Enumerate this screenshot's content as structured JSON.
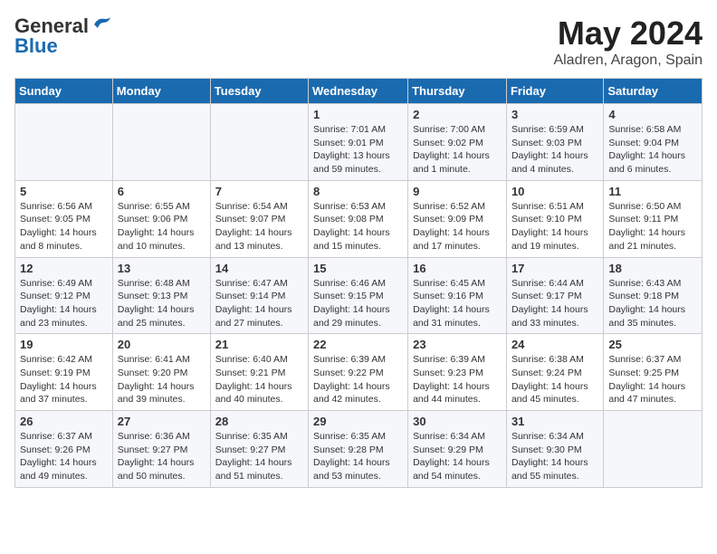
{
  "header": {
    "logo_general": "General",
    "logo_blue": "Blue",
    "month": "May 2024",
    "location": "Aladren, Aragon, Spain"
  },
  "weekdays": [
    "Sunday",
    "Monday",
    "Tuesday",
    "Wednesday",
    "Thursday",
    "Friday",
    "Saturday"
  ],
  "weeks": [
    [
      {
        "day": "",
        "info": ""
      },
      {
        "day": "",
        "info": ""
      },
      {
        "day": "",
        "info": ""
      },
      {
        "day": "1",
        "info": "Sunrise: 7:01 AM\nSunset: 9:01 PM\nDaylight: 13 hours and 59 minutes."
      },
      {
        "day": "2",
        "info": "Sunrise: 7:00 AM\nSunset: 9:02 PM\nDaylight: 14 hours and 1 minute."
      },
      {
        "day": "3",
        "info": "Sunrise: 6:59 AM\nSunset: 9:03 PM\nDaylight: 14 hours and 4 minutes."
      },
      {
        "day": "4",
        "info": "Sunrise: 6:58 AM\nSunset: 9:04 PM\nDaylight: 14 hours and 6 minutes."
      }
    ],
    [
      {
        "day": "5",
        "info": "Sunrise: 6:56 AM\nSunset: 9:05 PM\nDaylight: 14 hours and 8 minutes."
      },
      {
        "day": "6",
        "info": "Sunrise: 6:55 AM\nSunset: 9:06 PM\nDaylight: 14 hours and 10 minutes."
      },
      {
        "day": "7",
        "info": "Sunrise: 6:54 AM\nSunset: 9:07 PM\nDaylight: 14 hours and 13 minutes."
      },
      {
        "day": "8",
        "info": "Sunrise: 6:53 AM\nSunset: 9:08 PM\nDaylight: 14 hours and 15 minutes."
      },
      {
        "day": "9",
        "info": "Sunrise: 6:52 AM\nSunset: 9:09 PM\nDaylight: 14 hours and 17 minutes."
      },
      {
        "day": "10",
        "info": "Sunrise: 6:51 AM\nSunset: 9:10 PM\nDaylight: 14 hours and 19 minutes."
      },
      {
        "day": "11",
        "info": "Sunrise: 6:50 AM\nSunset: 9:11 PM\nDaylight: 14 hours and 21 minutes."
      }
    ],
    [
      {
        "day": "12",
        "info": "Sunrise: 6:49 AM\nSunset: 9:12 PM\nDaylight: 14 hours and 23 minutes."
      },
      {
        "day": "13",
        "info": "Sunrise: 6:48 AM\nSunset: 9:13 PM\nDaylight: 14 hours and 25 minutes."
      },
      {
        "day": "14",
        "info": "Sunrise: 6:47 AM\nSunset: 9:14 PM\nDaylight: 14 hours and 27 minutes."
      },
      {
        "day": "15",
        "info": "Sunrise: 6:46 AM\nSunset: 9:15 PM\nDaylight: 14 hours and 29 minutes."
      },
      {
        "day": "16",
        "info": "Sunrise: 6:45 AM\nSunset: 9:16 PM\nDaylight: 14 hours and 31 minutes."
      },
      {
        "day": "17",
        "info": "Sunrise: 6:44 AM\nSunset: 9:17 PM\nDaylight: 14 hours and 33 minutes."
      },
      {
        "day": "18",
        "info": "Sunrise: 6:43 AM\nSunset: 9:18 PM\nDaylight: 14 hours and 35 minutes."
      }
    ],
    [
      {
        "day": "19",
        "info": "Sunrise: 6:42 AM\nSunset: 9:19 PM\nDaylight: 14 hours and 37 minutes."
      },
      {
        "day": "20",
        "info": "Sunrise: 6:41 AM\nSunset: 9:20 PM\nDaylight: 14 hours and 39 minutes."
      },
      {
        "day": "21",
        "info": "Sunrise: 6:40 AM\nSunset: 9:21 PM\nDaylight: 14 hours and 40 minutes."
      },
      {
        "day": "22",
        "info": "Sunrise: 6:39 AM\nSunset: 9:22 PM\nDaylight: 14 hours and 42 minutes."
      },
      {
        "day": "23",
        "info": "Sunrise: 6:39 AM\nSunset: 9:23 PM\nDaylight: 14 hours and 44 minutes."
      },
      {
        "day": "24",
        "info": "Sunrise: 6:38 AM\nSunset: 9:24 PM\nDaylight: 14 hours and 45 minutes."
      },
      {
        "day": "25",
        "info": "Sunrise: 6:37 AM\nSunset: 9:25 PM\nDaylight: 14 hours and 47 minutes."
      }
    ],
    [
      {
        "day": "26",
        "info": "Sunrise: 6:37 AM\nSunset: 9:26 PM\nDaylight: 14 hours and 49 minutes."
      },
      {
        "day": "27",
        "info": "Sunrise: 6:36 AM\nSunset: 9:27 PM\nDaylight: 14 hours and 50 minutes."
      },
      {
        "day": "28",
        "info": "Sunrise: 6:35 AM\nSunset: 9:27 PM\nDaylight: 14 hours and 51 minutes."
      },
      {
        "day": "29",
        "info": "Sunrise: 6:35 AM\nSunset: 9:28 PM\nDaylight: 14 hours and 53 minutes."
      },
      {
        "day": "30",
        "info": "Sunrise: 6:34 AM\nSunset: 9:29 PM\nDaylight: 14 hours and 54 minutes."
      },
      {
        "day": "31",
        "info": "Sunrise: 6:34 AM\nSunset: 9:30 PM\nDaylight: 14 hours and 55 minutes."
      },
      {
        "day": "",
        "info": ""
      }
    ]
  ]
}
